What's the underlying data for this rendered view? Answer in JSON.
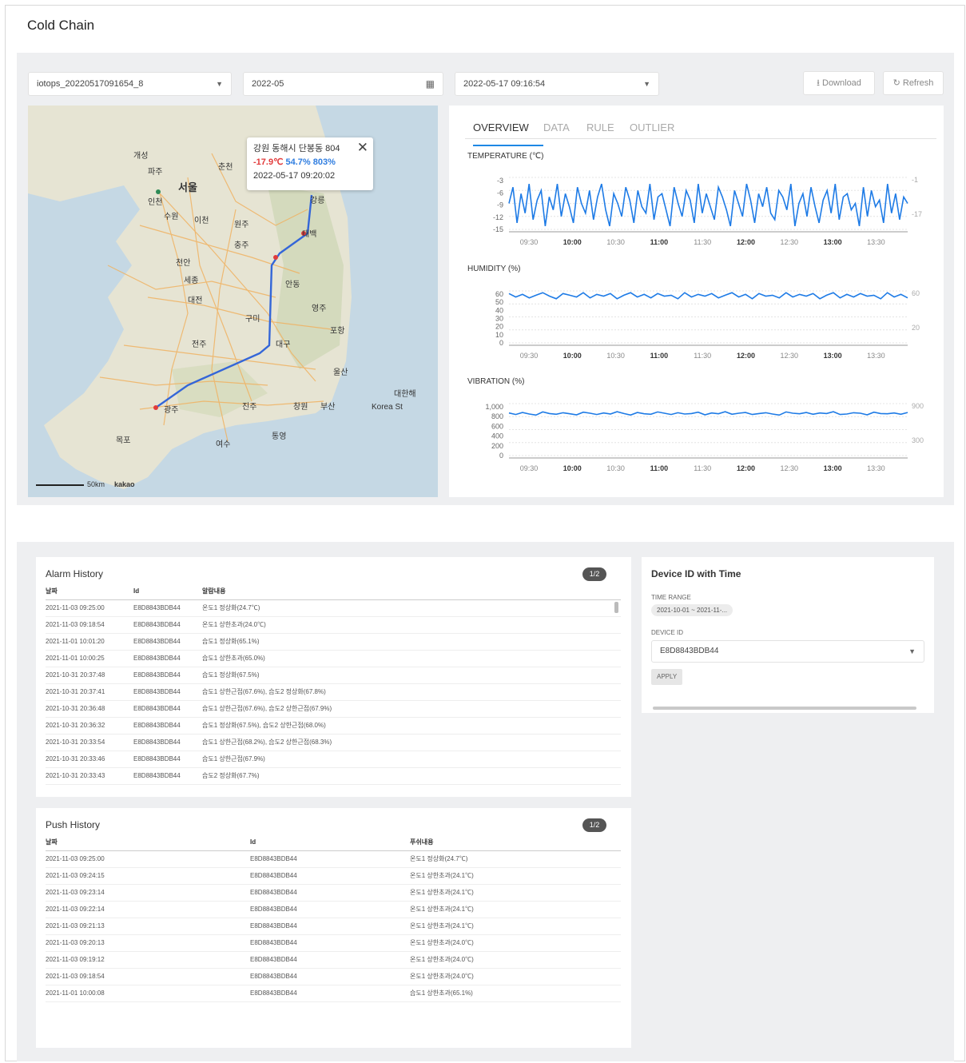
{
  "page": {
    "title": "Cold Chain"
  },
  "toolbar": {
    "device_select": "iotops_20220517091654_8",
    "month_input": "2022-05",
    "time_select": "2022-05-17 09:16:54",
    "download_label": "Download",
    "refresh_label": "Refresh"
  },
  "map": {
    "popup": {
      "address": "강원 동해시 단봉동 804",
      "temperature": "-17.9℃",
      "humidity": "54.7%",
      "vibration": "803%",
      "timestamp": "2022-05-17 09:20:02"
    },
    "scale_label": "50km",
    "brand_label": "kakao",
    "places": [
      "서울",
      "인천",
      "개성",
      "파주",
      "춘천",
      "수원",
      "이천",
      "원주",
      "충주",
      "천안",
      "세종",
      "대전",
      "안동",
      "구미",
      "대구",
      "전주",
      "광주",
      "포항",
      "울산",
      "진주",
      "창원",
      "부산",
      "목포",
      "여수",
      "통영",
      "강릉",
      "태백",
      "영주",
      "대한해",
      "Korea St"
    ],
    "colors": {
      "route": "#3466d8",
      "land": "#e8e6d8",
      "sea": "#c5d8e4",
      "road": "#f2b86a"
    }
  },
  "tabs": [
    "OVERVIEW",
    "DATA",
    "RULE",
    "OUTLIER"
  ],
  "charts": {
    "x_ticks": [
      "09:30",
      "10:00",
      "10:30",
      "11:00",
      "11:30",
      "12:00",
      "12:30",
      "13:00",
      "13:30"
    ],
    "temperature": {
      "title": "TEMPERATURE (℃)",
      "y_ticks": [
        "-3",
        "-6",
        "-9",
        "-12",
        "-15"
      ],
      "right_ticks": [
        "-1",
        "-17"
      ]
    },
    "humidity": {
      "title": "HUMIDITY (%)",
      "y_ticks": [
        "60",
        "50",
        "40",
        "30",
        "20",
        "10",
        "0"
      ],
      "right_ticks": [
        "60",
        "20"
      ]
    },
    "vibration": {
      "title": "VIBRATION (%)",
      "y_ticks": [
        "1,000",
        "800",
        "600",
        "400",
        "200",
        "0"
      ],
      "right_ticks": [
        "900",
        "300"
      ]
    }
  },
  "chart_data": [
    {
      "type": "line",
      "title": "TEMPERATURE (℃)",
      "ylim": [
        -17,
        -1
      ],
      "series": [
        {
          "values": [
            -9,
            -4,
            -15,
            -6,
            -12,
            -3,
            -14,
            -8,
            -5,
            -16,
            -7,
            -11,
            -3,
            -13,
            -6,
            -10,
            -15,
            -4,
            -9,
            -12,
            -5,
            -14,
            -7,
            -3,
            -11,
            -16,
            -6,
            -9,
            -13,
            -4,
            -8,
            -15,
            -5,
            -10,
            -12,
            -3,
            -14,
            -7,
            -6,
            -11,
            -16,
            -4,
            -9,
            -13,
            -5,
            -8,
            -15,
            -3,
            -12,
            -6,
            -10,
            -14,
            -4,
            -7,
            -11,
            -16,
            -5,
            -9,
            -13,
            -3,
            -8,
            -15,
            -6,
            -10,
            -4,
            -12,
            -14,
            -5,
            -7,
            -11,
            -3,
            -16,
            -9,
            -6,
            -13,
            -4,
            -10,
            -15,
            -8,
            -5,
            -12,
            -3,
            -14,
            -7,
            -6,
            -11,
            -9,
            -16,
            -4,
            -13,
            -5,
            -10,
            -8,
            -15,
            -3,
            -12,
            -6,
            -14,
            -7,
            -9
          ]
        }
      ]
    },
    {
      "type": "line",
      "title": "HUMIDITY (%)",
      "ylim": [
        0,
        60
      ],
      "series": [
        {
          "values": [
            57,
            53,
            56,
            52,
            55,
            58,
            54,
            51,
            57,
            55,
            53,
            58,
            52,
            56,
            54,
            57,
            51,
            55,
            58,
            53,
            56,
            52,
            57,
            54,
            55,
            51,
            58,
            53,
            56,
            54,
            57,
            52,
            55,
            58,
            53,
            56,
            51,
            57,
            54,
            55,
            52,
            58,
            53,
            56,
            54,
            57,
            51,
            55,
            58,
            52,
            56,
            53,
            57,
            54,
            55,
            51,
            58,
            53,
            56,
            52
          ]
        }
      ]
    },
    {
      "type": "line",
      "title": "VIBRATION (%)",
      "ylim": [
        0,
        1000
      ],
      "series": [
        {
          "values": [
            820,
            790,
            830,
            800,
            780,
            840,
            810,
            795,
            825,
            805,
            785,
            835,
            815,
            790,
            820,
            800,
            845,
            810,
            780,
            830,
            805,
            795,
            840,
            815,
            790,
            825,
            800,
            810,
            835,
            785,
            820,
            805,
            845,
            795,
            815,
            830,
            790,
            810,
            825,
            800,
            780,
            840,
            815,
            805,
            830,
            795,
            820,
            810,
            845,
            790,
            800,
            825,
            815,
            785,
            835,
            810,
            805,
            820,
            795,
            830
          ]
        }
      ]
    }
  ],
  "alarm_history": {
    "title": "Alarm History",
    "count": "1/2",
    "columns": [
      "날짜",
      "Id",
      "알람내용"
    ],
    "rows": [
      [
        "2021-11-03 09:25:00",
        "E8D8843BDB44",
        "온도1 정상화(24.7℃)"
      ],
      [
        "2021-11-03 09:18:54",
        "E8D8843BDB44",
        "온도1 상한초과(24.0℃)"
      ],
      [
        "2021-11-01 10:01:20",
        "E8D8843BDB44",
        "습도1 정상화(65.1%)"
      ],
      [
        "2021-11-01 10:00:25",
        "E8D8843BDB44",
        "습도1 상한초과(65.0%)"
      ],
      [
        "2021-10-31 20:37:48",
        "E8D8843BDB44",
        "습도1 정상화(67.5%)"
      ],
      [
        "2021-10-31 20:37:41",
        "E8D8843BDB44",
        "습도1 상한근접(67.6%), 습도2 정상화(67.8%)"
      ],
      [
        "2021-10-31 20:36:48",
        "E8D8843BDB44",
        "습도1 상한근접(67.6%), 습도2 상한근접(67.9%)"
      ],
      [
        "2021-10-31 20:36:32",
        "E8D8843BDB44",
        "습도1 정상화(67.5%), 습도2 상한근접(68.0%)"
      ],
      [
        "2021-10-31 20:33:54",
        "E8D8843BDB44",
        "습도1 상한근접(68.2%), 습도2 상한근접(68.3%)"
      ],
      [
        "2021-10-31 20:33:46",
        "E8D8843BDB44",
        "습도1 상한근접(67.9%)"
      ],
      [
        "2021-10-31 20:33:43",
        "E8D8843BDB44",
        "습도2 정상화(67.7%)"
      ]
    ]
  },
  "push_history": {
    "title": "Push History",
    "count": "1/2",
    "columns": [
      "날짜",
      "Id",
      "푸쉬내용"
    ],
    "rows": [
      [
        "2021-11-03 09:25:00",
        "E8D8843BDB44",
        "온도1 정상화(24.7℃)"
      ],
      [
        "2021-11-03 09:24:15",
        "E8D8843BDB44",
        "온도1 상한초과(24.1℃)"
      ],
      [
        "2021-11-03 09:23:14",
        "E8D8843BDB44",
        "온도1 상한초과(24.1℃)"
      ],
      [
        "2021-11-03 09:22:14",
        "E8D8843BDB44",
        "온도1 상한초과(24.1℃)"
      ],
      [
        "2021-11-03 09:21:13",
        "E8D8843BDB44",
        "온도1 상한초과(24.1℃)"
      ],
      [
        "2021-11-03 09:20:13",
        "E8D8843BDB44",
        "온도1 상한초과(24.0℃)"
      ],
      [
        "2021-11-03 09:19:12",
        "E8D8843BDB44",
        "온도1 상한초과(24.0℃)"
      ],
      [
        "2021-11-03 09:18:54",
        "E8D8843BDB44",
        "온도1 상한초과(24.0℃)"
      ],
      [
        "2021-11-01 10:00:08",
        "E8D8843BDB44",
        "습도1 상한초과(65.1%)"
      ]
    ]
  },
  "device_panel": {
    "title": "Device ID with Time",
    "time_range_label": "TIME RANGE",
    "time_range_value": "2021-10-01 ~ 2021-11-...",
    "device_id_label": "DEVICE ID",
    "device_id_value": "E8D8843BDB44",
    "apply_label": "APPLY"
  }
}
